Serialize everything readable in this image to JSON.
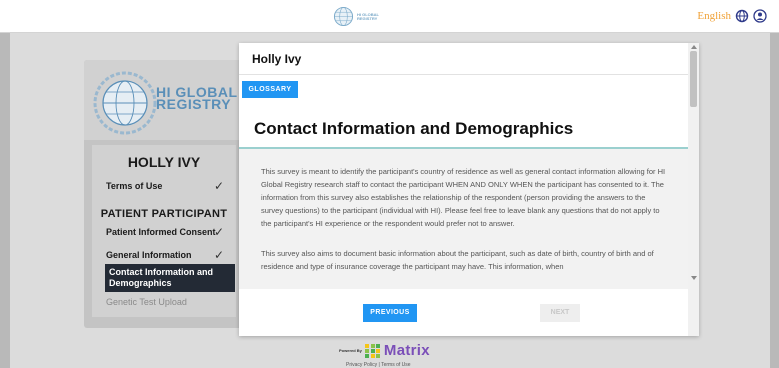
{
  "header": {
    "logo_text_line1": "HI GLOBAL",
    "logo_text_line2": "REGISTRY",
    "language": "English",
    "icons": [
      "globe-icon",
      "user-icon"
    ]
  },
  "sidebar": {
    "logo_line1": "HI GLOBAL",
    "logo_line2": "REGISTRY",
    "participant_name": "HOLLY IVY",
    "steps_top": [
      {
        "label": "Terms of Use",
        "done": true
      }
    ],
    "section_label": "PATIENT PARTICIPANT",
    "steps": [
      {
        "label": "Patient Informed Consent",
        "done": true
      },
      {
        "label": "General Information",
        "done": true
      },
      {
        "label": "Contact Information and Demographics",
        "active": true
      },
      {
        "label": "Genetic Test Upload",
        "disabled": true
      }
    ]
  },
  "modal": {
    "title": "Holly Ivy",
    "glossary_label": "GLOSSARY",
    "section_title": "Contact Information and Demographics",
    "paragraphs": [
      "This survey is meant to identify the participant's country of residence as well as general contact information allowing for HI Global Registry research staff to contact the participant WHEN AND ONLY WHEN the participant has consented to it. The information from this survey also establishes the relationship of the respondent (person providing the answers to the survey questions) to the participant (individual with HI). Please feel free to leave blank any questions that do not apply to the participant's HI experience or the respondent would prefer not to answer.",
      "This survey also aims to document basic information about the participant, such as date of birth, country of birth and of residence and type of insurance coverage the participant may have. This information, when"
    ],
    "previous_label": "PREVIOUS",
    "next_label": "NEXT"
  },
  "footer": {
    "powered_by": "Powered By",
    "brand": "Matrix",
    "links": "Privacy Policy | Terms of Use"
  },
  "colors": {
    "accent_blue": "#2196f3",
    "active_step": "#232a35",
    "language_orange": "#f0a238",
    "matrix_purple": "#7b4fb8",
    "title_rule": "#9bd0cf"
  }
}
